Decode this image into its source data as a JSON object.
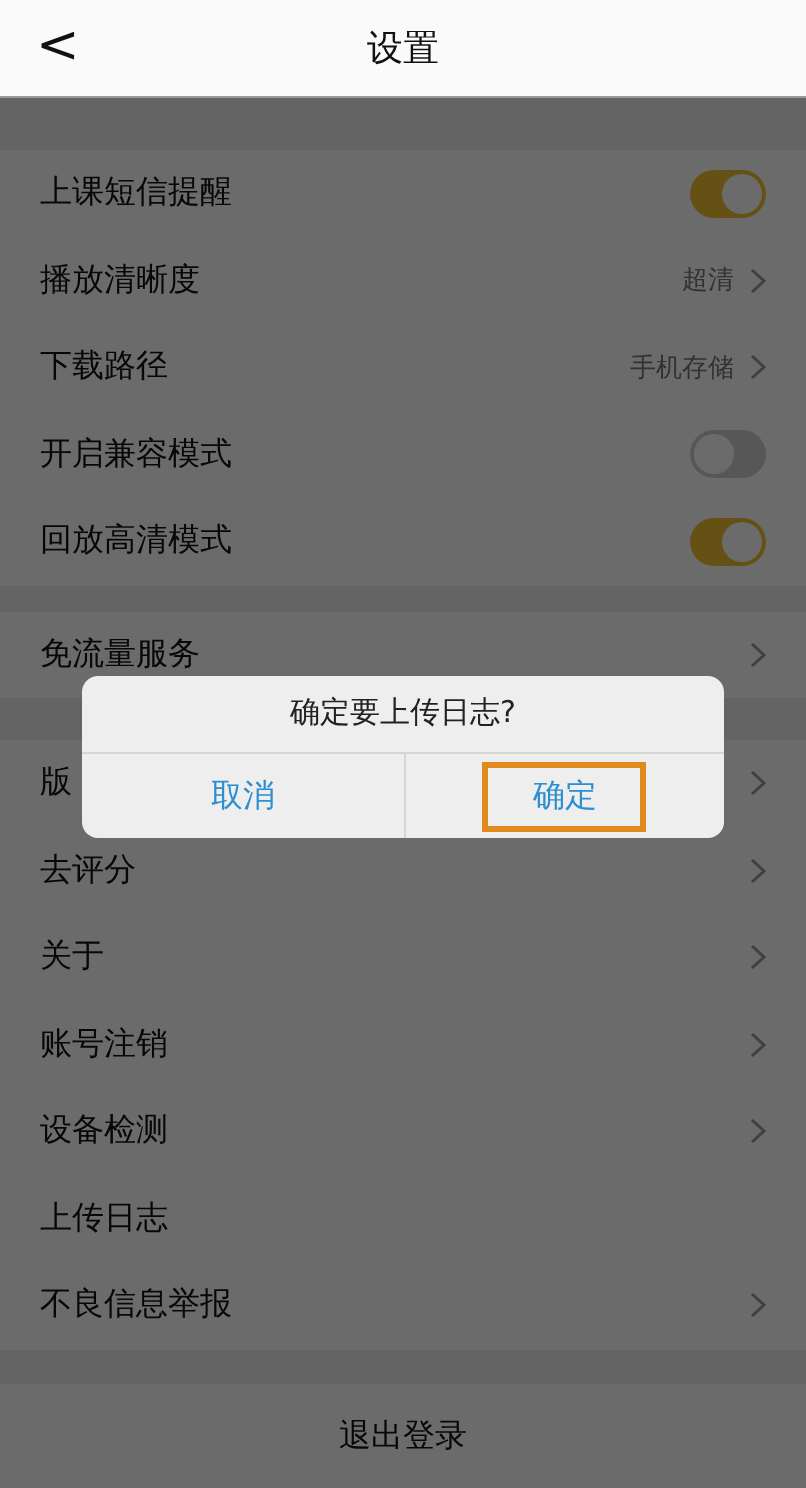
{
  "header": {
    "back": "<",
    "title": "设置"
  },
  "groups": [
    {
      "items": [
        {
          "label": "上课短信提醒",
          "kind": "toggle",
          "on": true
        },
        {
          "label": "播放清晰度",
          "kind": "link",
          "value": "超清"
        },
        {
          "label": "下载路径",
          "kind": "link",
          "value": "手机存储"
        },
        {
          "label": "开启兼容模式",
          "kind": "toggle",
          "on": false
        },
        {
          "label": "回放高清模式",
          "kind": "toggle",
          "on": true
        }
      ]
    },
    {
      "items": [
        {
          "label": "免流量服务",
          "kind": "link"
        }
      ]
    },
    {
      "items": [
        {
          "label": "版",
          "kind": "link"
        },
        {
          "label": "去评分",
          "kind": "link"
        },
        {
          "label": "关于",
          "kind": "link"
        },
        {
          "label": "账号注销",
          "kind": "link"
        },
        {
          "label": "设备检测",
          "kind": "link"
        },
        {
          "label": "上传日志",
          "kind": "plain"
        },
        {
          "label": "不良信息举报",
          "kind": "link"
        }
      ]
    }
  ],
  "logout": "退出登录",
  "dialog": {
    "message": "确定要上传日志?",
    "buttons": [
      {
        "label": "取消",
        "highlighted": false
      },
      {
        "label": "确定",
        "highlighted": true
      }
    ]
  }
}
